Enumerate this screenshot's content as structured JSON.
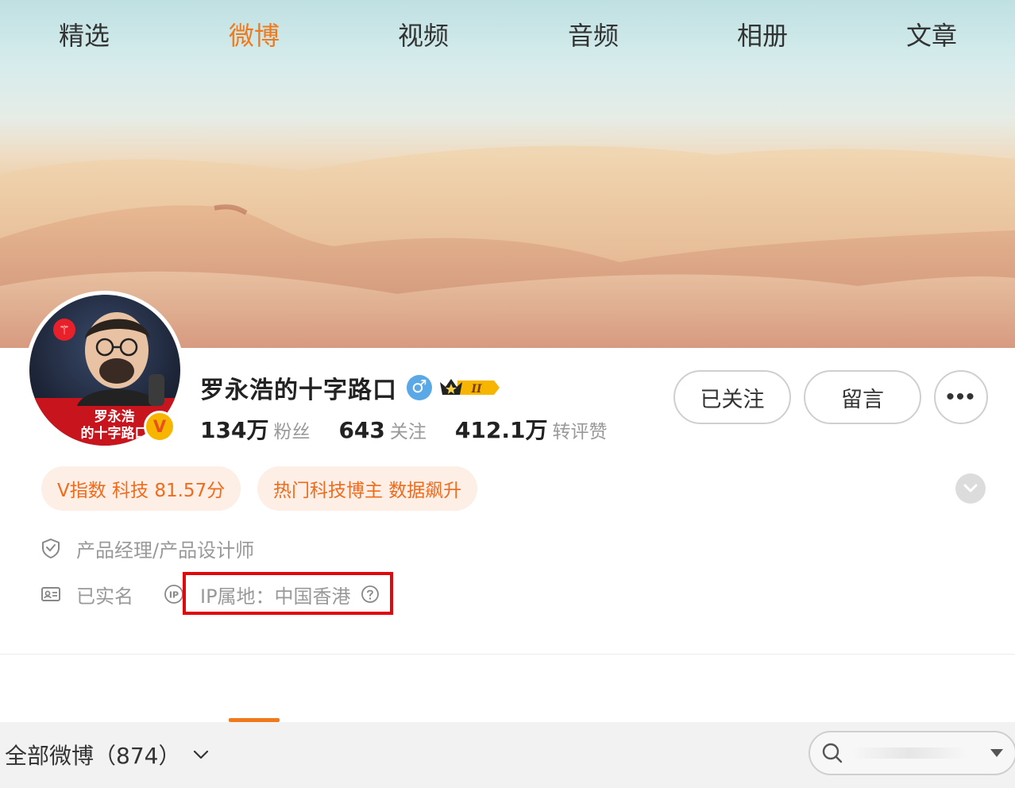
{
  "profile": {
    "name": "罗永浩的十字路口",
    "avatar_caption_line1": "罗永浩",
    "avatar_caption_line2": "的十字路口",
    "verified_mark": "V",
    "gender_symbol": "♂",
    "vip_level": "II"
  },
  "stats": [
    {
      "value": "134万",
      "label": "粉丝"
    },
    {
      "value": "643",
      "label": "关注"
    },
    {
      "value": "412.1万",
      "label": "转评赞"
    }
  ],
  "actions": {
    "follow_label": "已关注",
    "message_label": "留言",
    "more_label": "•••"
  },
  "tags": {
    "v_index": "V指数 科技 81.57分",
    "hot": "热门科技博主 数据飙升"
  },
  "info": {
    "job": "产品经理/产品设计师",
    "real_name": "已实名",
    "ip_location": "IP属地：中国香港"
  },
  "tabs": [
    "精选",
    "微博",
    "视频",
    "音频",
    "相册",
    "文章"
  ],
  "active_tab": "微博",
  "filter": {
    "label": "全部微博（874）"
  },
  "icons": {
    "gender": "male-icon",
    "vip": "crown-icon",
    "job": "shield-check-icon",
    "real_name": "id-card-icon",
    "ip": "ip-icon",
    "help": "question-icon",
    "search": "search-icon",
    "expand": "chevron-down-icon"
  },
  "colors": {
    "accent": "#f07a1b",
    "tag_bg": "#fdeee6",
    "highlight": "#e0080d",
    "gender": "#5aa9e6"
  }
}
